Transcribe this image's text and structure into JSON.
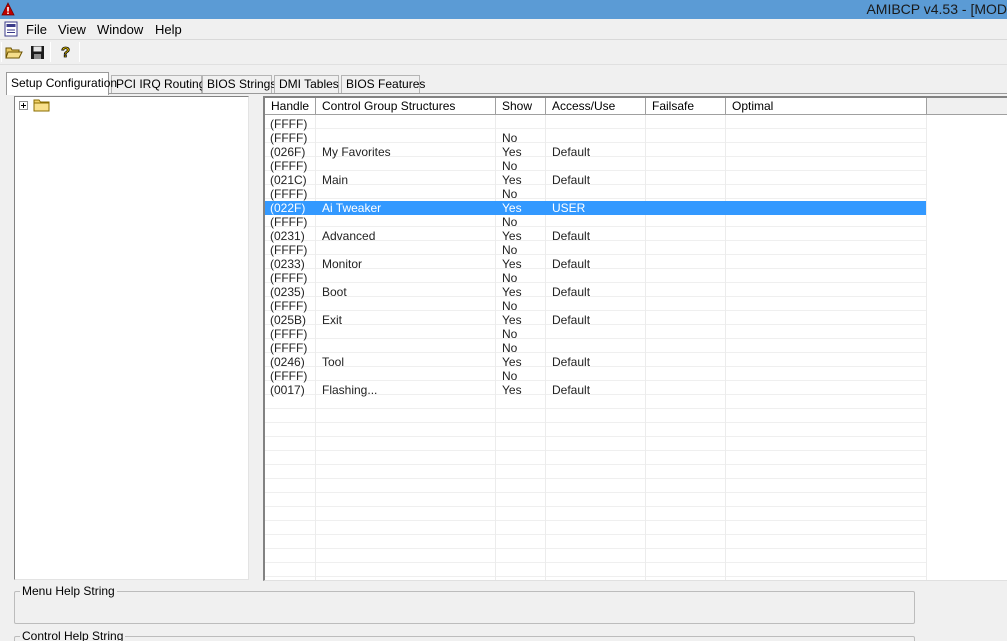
{
  "window": {
    "title": "AMIBCP v4.53 - [MOD"
  },
  "menu": [
    "File",
    "View",
    "Window",
    "Help"
  ],
  "toolbar": {
    "buttons": [
      "open-icon",
      "save-icon",
      "help-icon"
    ]
  },
  "tabs": [
    "Setup Configuration",
    "PCI IRQ Routing",
    "BIOS Strings",
    "DMI Tables",
    "BIOS Features"
  ],
  "active_tab": "Setup Configuration",
  "grid": {
    "columns": [
      "Handle",
      "Control Group Structures",
      "Show",
      "Access/Use",
      "Failsafe",
      "Optimal"
    ],
    "rows": [
      {
        "handle": "(FFFF)",
        "name": "",
        "show": "",
        "access": "",
        "failsafe": "",
        "optimal": ""
      },
      {
        "handle": "(FFFF)",
        "name": "",
        "show": "No",
        "access": "",
        "failsafe": "",
        "optimal": ""
      },
      {
        "handle": "(026F)",
        "name": "My Favorites",
        "show": "Yes",
        "access": "Default",
        "failsafe": "",
        "optimal": ""
      },
      {
        "handle": "(FFFF)",
        "name": "",
        "show": "No",
        "access": "",
        "failsafe": "",
        "optimal": ""
      },
      {
        "handle": "(021C)",
        "name": "Main",
        "show": "Yes",
        "access": "Default",
        "failsafe": "",
        "optimal": ""
      },
      {
        "handle": "(FFFF)",
        "name": "",
        "show": "No",
        "access": "",
        "failsafe": "",
        "optimal": ""
      },
      {
        "handle": "(022F)",
        "name": "Ai Tweaker",
        "show": "Yes",
        "access": "USER",
        "failsafe": "",
        "optimal": "",
        "selected": true
      },
      {
        "handle": "(FFFF)",
        "name": "",
        "show": "No",
        "access": "",
        "failsafe": "",
        "optimal": ""
      },
      {
        "handle": "(0231)",
        "name": "Advanced",
        "show": "Yes",
        "access": "Default",
        "failsafe": "",
        "optimal": ""
      },
      {
        "handle": "(FFFF)",
        "name": "",
        "show": "No",
        "access": "",
        "failsafe": "",
        "optimal": ""
      },
      {
        "handle": "(0233)",
        "name": "Monitor",
        "show": "Yes",
        "access": "Default",
        "failsafe": "",
        "optimal": ""
      },
      {
        "handle": "(FFFF)",
        "name": "",
        "show": "No",
        "access": "",
        "failsafe": "",
        "optimal": ""
      },
      {
        "handle": "(0235)",
        "name": "Boot",
        "show": "Yes",
        "access": "Default",
        "failsafe": "",
        "optimal": ""
      },
      {
        "handle": "(FFFF)",
        "name": "",
        "show": "No",
        "access": "",
        "failsafe": "",
        "optimal": ""
      },
      {
        "handle": "(025B)",
        "name": "Exit",
        "show": "Yes",
        "access": "Default",
        "failsafe": "",
        "optimal": ""
      },
      {
        "handle": "(FFFF)",
        "name": "",
        "show": "No",
        "access": "",
        "failsafe": "",
        "optimal": ""
      },
      {
        "handle": "(FFFF)",
        "name": "",
        "show": "No",
        "access": "",
        "failsafe": "",
        "optimal": ""
      },
      {
        "handle": "(0246)",
        "name": "Tool",
        "show": "Yes",
        "access": "Default",
        "failsafe": "",
        "optimal": ""
      },
      {
        "handle": "(FFFF)",
        "name": "",
        "show": "No",
        "access": "",
        "failsafe": "",
        "optimal": ""
      },
      {
        "handle": "(0017)",
        "name": "Flashing...",
        "show": "Yes",
        "access": "Default",
        "failsafe": "",
        "optimal": ""
      }
    ]
  },
  "help": {
    "menu_help_label": "Menu Help String",
    "control_help_label": "Control Help String"
  },
  "colors": {
    "titlebar": "#5b9bd5",
    "selection": "#3399ff"
  }
}
